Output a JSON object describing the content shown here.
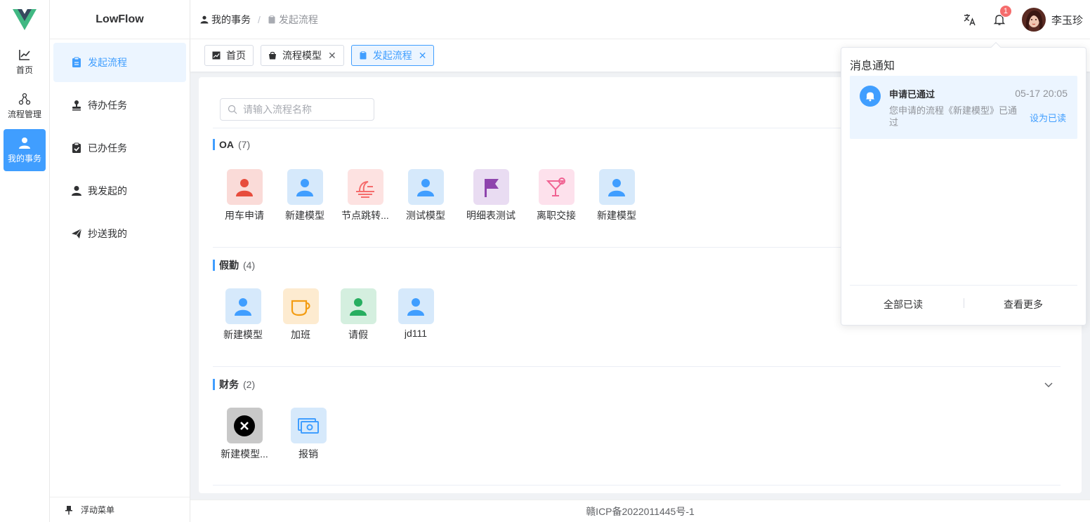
{
  "rail": {
    "items": [
      {
        "label": "首页",
        "icon": "trend-chart-icon"
      },
      {
        "label": "流程管理",
        "icon": "flow-tree-icon"
      },
      {
        "label": "我的事务",
        "icon": "user-icon"
      }
    ]
  },
  "menu": {
    "brand": "LowFlow",
    "items": [
      {
        "label": "发起流程",
        "icon": "clipboard-icon"
      },
      {
        "label": "待办任务",
        "icon": "stamp-icon"
      },
      {
        "label": "已办任务",
        "icon": "checked-clipboard-icon"
      },
      {
        "label": "我发起的",
        "icon": "user-icon"
      },
      {
        "label": "抄送我的",
        "icon": "paper-plane-icon"
      }
    ],
    "footer": "浮动菜单"
  },
  "header": {
    "breadcrumb": [
      "我的事务",
      "/",
      "发起流程"
    ],
    "username": "李玉珍",
    "notification_count": "1"
  },
  "tabs": [
    {
      "label": "首页"
    },
    {
      "label": "流程模型"
    },
    {
      "label": "发起流程"
    }
  ],
  "search": {
    "placeholder": "请输入流程名称"
  },
  "groups": [
    {
      "name": "OA",
      "count": "(7)",
      "apps": [
        {
          "label": "用车申请",
          "icon": "user-icon",
          "bg": "#fadbd8",
          "color": "#e74c3c"
        },
        {
          "label": "新建模型",
          "icon": "user-icon",
          "bg": "#d6e9fb",
          "color": "#409eff"
        },
        {
          "label": "节点跳转...",
          "icon": "sunset-icon",
          "bg": "#fde2e1",
          "color": "#f56c6c"
        },
        {
          "label": "测试模型",
          "icon": "user-icon",
          "bg": "#d6e9fb",
          "color": "#409eff"
        },
        {
          "label": "明细表测试",
          "icon": "flag-icon",
          "bg": "#e9dcf2",
          "color": "#8e44ad"
        },
        {
          "label": "离职交接",
          "icon": "cocktail-icon",
          "bg": "#fde1ec",
          "color": "#f06292"
        },
        {
          "label": "新建模型",
          "icon": "user-icon",
          "bg": "#d6e9fb",
          "color": "#409eff"
        }
      ]
    },
    {
      "name": "假勤",
      "count": "(4)",
      "apps": [
        {
          "label": "新建模型",
          "icon": "user-icon",
          "bg": "#d6e9fb",
          "color": "#409eff"
        },
        {
          "label": "加班",
          "icon": "coffee-cup-icon",
          "bg": "#fdebd0",
          "color": "#f39c12"
        },
        {
          "label": "请假",
          "icon": "user-icon",
          "bg": "#d4efdf",
          "color": "#27ae60"
        },
        {
          "label": "jd111",
          "icon": "user-icon",
          "bg": "#d6e9fb",
          "color": "#409eff"
        }
      ]
    },
    {
      "name": "财务",
      "count": "(2)",
      "apps": [
        {
          "label": "新建模型...",
          "icon": "close-circle-icon",
          "bg": "#c8c8c8",
          "color": "#000000"
        },
        {
          "label": "报销",
          "icon": "money-icon",
          "bg": "#d6e9fb",
          "color": "#409eff"
        }
      ]
    }
  ],
  "footer": {
    "icp": "赣ICP备2022011445号-1"
  },
  "notifications": {
    "title": "消息通知",
    "items": [
      {
        "title": "申请已通过",
        "time": "05-17 20:05",
        "content": "您申请的流程《新建模型》已通过",
        "action": "设为已读"
      }
    ],
    "mark_all": "全部已读",
    "view_more": "查看更多"
  },
  "colors": {
    "accent": "#409eff",
    "active_bg": "#ecf5ff",
    "badge": "#f56c6c",
    "logo_green": "#41b883",
    "logo_dark": "#35495e"
  }
}
